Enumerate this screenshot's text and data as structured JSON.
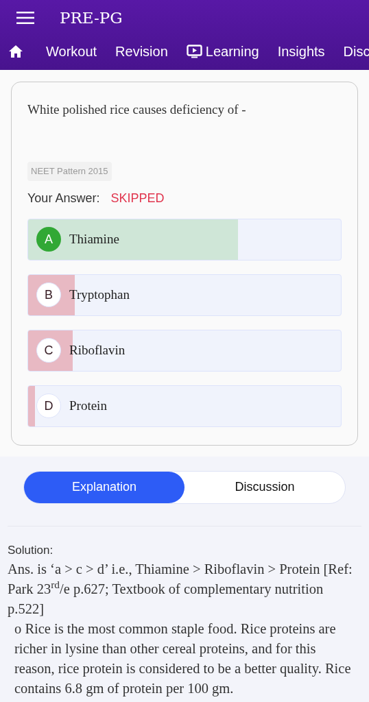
{
  "app_bar": {
    "title": "PRE-PG"
  },
  "nav": [
    {
      "label": "Workout",
      "kind": "plain"
    },
    {
      "label": "Revision",
      "kind": "plain"
    },
    {
      "label": "Learning",
      "kind": "media"
    },
    {
      "label": "Insights",
      "kind": "plain"
    },
    {
      "label": "Disc",
      "kind": "plain"
    }
  ],
  "question": {
    "text": "White polished rice causes deficiency of -",
    "tag": "NEET Pattern 2015",
    "answer_label": "Your Answer:",
    "answer_value": "SKIPPED"
  },
  "options": [
    {
      "letter": "A",
      "text": "Thiamine",
      "correct": true,
      "level": 0.67
    },
    {
      "letter": "B",
      "text": "Tryptophan",
      "correct": false,
      "level": 0.15
    },
    {
      "letter": "C",
      "text": "Riboflavin",
      "correct": false,
      "level": 0.142
    },
    {
      "letter": "D",
      "text": "Protein",
      "correct": false,
      "level": 0.022
    }
  ],
  "tabs": [
    {
      "label": "Explanation",
      "selected": true
    },
    {
      "label": "Discussion",
      "selected": false
    }
  ],
  "solution": {
    "heading": "Solution:",
    "answer": "Ans. is ‘a > c > d’ i.e., Thiamine > Riboflavin > Protein [Ref: Park 23$^{rd}$/e p.627; Textbook of complementary nutrition p.522]",
    "point": "o Rice is the most common staple food. Rice proteins are richer in lysine than other cereal proteins, and for this reason, rice protein is considered to be a better quality. Rice contains 6.8 gm of protein per 100 gm."
  }
}
